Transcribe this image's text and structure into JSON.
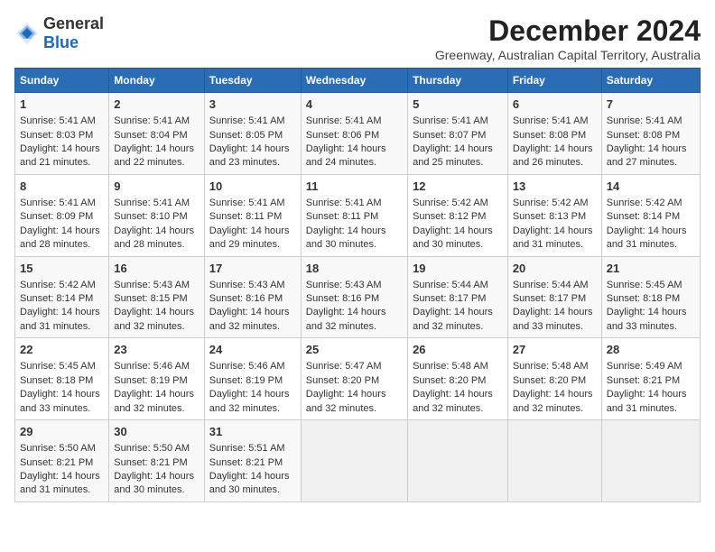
{
  "logo": {
    "general": "General",
    "blue": "Blue"
  },
  "title": "December 2024",
  "subtitle": "Greenway, Australian Capital Territory, Australia",
  "headers": [
    "Sunday",
    "Monday",
    "Tuesday",
    "Wednesday",
    "Thursday",
    "Friday",
    "Saturday"
  ],
  "weeks": [
    [
      {
        "day": "1",
        "sunrise": "Sunrise: 5:41 AM",
        "sunset": "Sunset: 8:03 PM",
        "daylight": "Daylight: 14 hours and 21 minutes."
      },
      {
        "day": "2",
        "sunrise": "Sunrise: 5:41 AM",
        "sunset": "Sunset: 8:04 PM",
        "daylight": "Daylight: 14 hours and 22 minutes."
      },
      {
        "day": "3",
        "sunrise": "Sunrise: 5:41 AM",
        "sunset": "Sunset: 8:05 PM",
        "daylight": "Daylight: 14 hours and 23 minutes."
      },
      {
        "day": "4",
        "sunrise": "Sunrise: 5:41 AM",
        "sunset": "Sunset: 8:06 PM",
        "daylight": "Daylight: 14 hours and 24 minutes."
      },
      {
        "day": "5",
        "sunrise": "Sunrise: 5:41 AM",
        "sunset": "Sunset: 8:07 PM",
        "daylight": "Daylight: 14 hours and 25 minutes."
      },
      {
        "day": "6",
        "sunrise": "Sunrise: 5:41 AM",
        "sunset": "Sunset: 8:08 PM",
        "daylight": "Daylight: 14 hours and 26 minutes."
      },
      {
        "day": "7",
        "sunrise": "Sunrise: 5:41 AM",
        "sunset": "Sunset: 8:08 PM",
        "daylight": "Daylight: 14 hours and 27 minutes."
      }
    ],
    [
      {
        "day": "8",
        "sunrise": "Sunrise: 5:41 AM",
        "sunset": "Sunset: 8:09 PM",
        "daylight": "Daylight: 14 hours and 28 minutes."
      },
      {
        "day": "9",
        "sunrise": "Sunrise: 5:41 AM",
        "sunset": "Sunset: 8:10 PM",
        "daylight": "Daylight: 14 hours and 28 minutes."
      },
      {
        "day": "10",
        "sunrise": "Sunrise: 5:41 AM",
        "sunset": "Sunset: 8:11 PM",
        "daylight": "Daylight: 14 hours and 29 minutes."
      },
      {
        "day": "11",
        "sunrise": "Sunrise: 5:41 AM",
        "sunset": "Sunset: 8:11 PM",
        "daylight": "Daylight: 14 hours and 30 minutes."
      },
      {
        "day": "12",
        "sunrise": "Sunrise: 5:42 AM",
        "sunset": "Sunset: 8:12 PM",
        "daylight": "Daylight: 14 hours and 30 minutes."
      },
      {
        "day": "13",
        "sunrise": "Sunrise: 5:42 AM",
        "sunset": "Sunset: 8:13 PM",
        "daylight": "Daylight: 14 hours and 31 minutes."
      },
      {
        "day": "14",
        "sunrise": "Sunrise: 5:42 AM",
        "sunset": "Sunset: 8:14 PM",
        "daylight": "Daylight: 14 hours and 31 minutes."
      }
    ],
    [
      {
        "day": "15",
        "sunrise": "Sunrise: 5:42 AM",
        "sunset": "Sunset: 8:14 PM",
        "daylight": "Daylight: 14 hours and 31 minutes."
      },
      {
        "day": "16",
        "sunrise": "Sunrise: 5:43 AM",
        "sunset": "Sunset: 8:15 PM",
        "daylight": "Daylight: 14 hours and 32 minutes."
      },
      {
        "day": "17",
        "sunrise": "Sunrise: 5:43 AM",
        "sunset": "Sunset: 8:16 PM",
        "daylight": "Daylight: 14 hours and 32 minutes."
      },
      {
        "day": "18",
        "sunrise": "Sunrise: 5:43 AM",
        "sunset": "Sunset: 8:16 PM",
        "daylight": "Daylight: 14 hours and 32 minutes."
      },
      {
        "day": "19",
        "sunrise": "Sunrise: 5:44 AM",
        "sunset": "Sunset: 8:17 PM",
        "daylight": "Daylight: 14 hours and 32 minutes."
      },
      {
        "day": "20",
        "sunrise": "Sunrise: 5:44 AM",
        "sunset": "Sunset: 8:17 PM",
        "daylight": "Daylight: 14 hours and 33 minutes."
      },
      {
        "day": "21",
        "sunrise": "Sunrise: 5:45 AM",
        "sunset": "Sunset: 8:18 PM",
        "daylight": "Daylight: 14 hours and 33 minutes."
      }
    ],
    [
      {
        "day": "22",
        "sunrise": "Sunrise: 5:45 AM",
        "sunset": "Sunset: 8:18 PM",
        "daylight": "Daylight: 14 hours and 33 minutes."
      },
      {
        "day": "23",
        "sunrise": "Sunrise: 5:46 AM",
        "sunset": "Sunset: 8:19 PM",
        "daylight": "Daylight: 14 hours and 32 minutes."
      },
      {
        "day": "24",
        "sunrise": "Sunrise: 5:46 AM",
        "sunset": "Sunset: 8:19 PM",
        "daylight": "Daylight: 14 hours and 32 minutes."
      },
      {
        "day": "25",
        "sunrise": "Sunrise: 5:47 AM",
        "sunset": "Sunset: 8:20 PM",
        "daylight": "Daylight: 14 hours and 32 minutes."
      },
      {
        "day": "26",
        "sunrise": "Sunrise: 5:48 AM",
        "sunset": "Sunset: 8:20 PM",
        "daylight": "Daylight: 14 hours and 32 minutes."
      },
      {
        "day": "27",
        "sunrise": "Sunrise: 5:48 AM",
        "sunset": "Sunset: 8:20 PM",
        "daylight": "Daylight: 14 hours and 32 minutes."
      },
      {
        "day": "28",
        "sunrise": "Sunrise: 5:49 AM",
        "sunset": "Sunset: 8:21 PM",
        "daylight": "Daylight: 14 hours and 31 minutes."
      }
    ],
    [
      {
        "day": "29",
        "sunrise": "Sunrise: 5:50 AM",
        "sunset": "Sunset: 8:21 PM",
        "daylight": "Daylight: 14 hours and 31 minutes."
      },
      {
        "day": "30",
        "sunrise": "Sunrise: 5:50 AM",
        "sunset": "Sunset: 8:21 PM",
        "daylight": "Daylight: 14 hours and 30 minutes."
      },
      {
        "day": "31",
        "sunrise": "Sunrise: 5:51 AM",
        "sunset": "Sunset: 8:21 PM",
        "daylight": "Daylight: 14 hours and 30 minutes."
      },
      null,
      null,
      null,
      null
    ]
  ]
}
